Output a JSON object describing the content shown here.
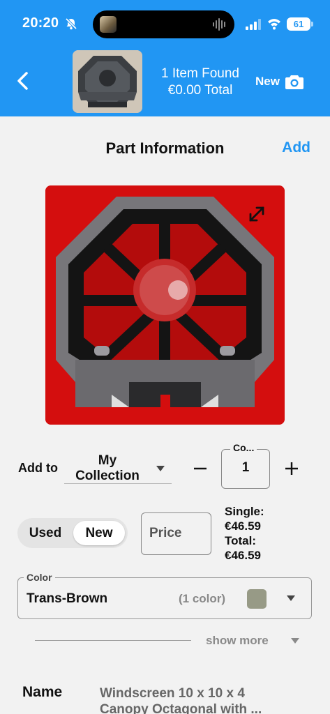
{
  "status_bar": {
    "time": "20:20",
    "battery": "61",
    "icons": [
      "bell-slash-icon",
      "signal-icon",
      "wifi-icon",
      "battery-icon"
    ]
  },
  "header": {
    "items_found": "1 Item Found",
    "total": "€0.00 Total",
    "new_label": "New",
    "accent_color": "#2196f3"
  },
  "page": {
    "title": "Part Information",
    "add_label": "Add"
  },
  "add_to": {
    "label": "Add to",
    "collection_line1": "My",
    "collection_line2": "Collection",
    "quantity_label": "Co...",
    "quantity_value": "1"
  },
  "condition": {
    "options": [
      "Used",
      "New"
    ],
    "selected": "New",
    "price_placeholder": "Price",
    "single_label": "Single:",
    "single_value": "€46.59",
    "total_label": "Total:",
    "total_value": "€46.59"
  },
  "color": {
    "label": "Color",
    "value": "Trans-Brown",
    "count": "(1 color)",
    "swatch": "#979a86"
  },
  "show_more": "show more",
  "details": {
    "name_label": "Name",
    "name_line1": "Windscreen 10 x 10 x 4",
    "name_line2": "Canopy Octagonal with ..."
  }
}
